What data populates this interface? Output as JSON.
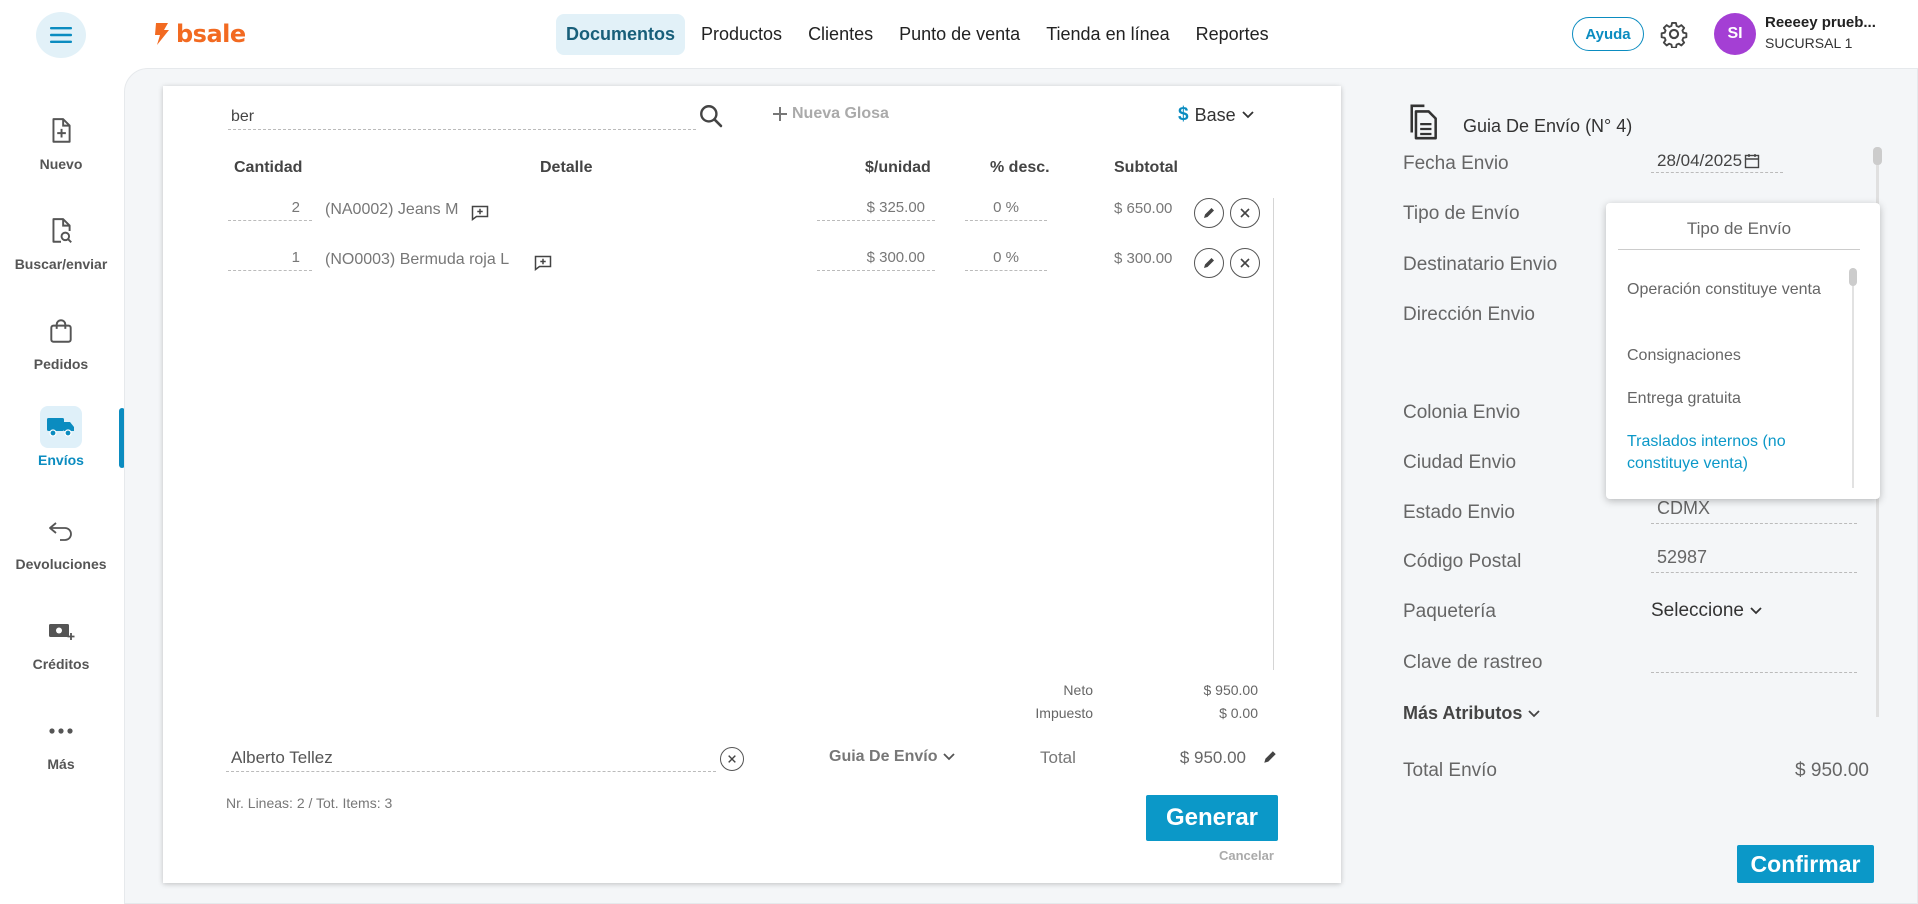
{
  "topbar": {
    "logo_text": "bsale",
    "nav": [
      "Documentos",
      "Productos",
      "Clientes",
      "Punto de venta",
      "Tienda en línea",
      "Reportes"
    ],
    "help_label": "Ayuda",
    "avatar_initials": "SI",
    "user_name": "Reeeey prueb...",
    "user_branch": "SUCURSAL 1"
  },
  "sidebar": {
    "items": [
      {
        "label": "Nuevo",
        "icon": "file-plus-icon"
      },
      {
        "label": "Buscar/enviar",
        "icon": "file-search-icon"
      },
      {
        "label": "Pedidos",
        "icon": "shopping-bag-icon"
      },
      {
        "label": "Envíos",
        "icon": "truck-icon"
      },
      {
        "label": "Devoluciones",
        "icon": "return-arrow-icon"
      },
      {
        "label": "Créditos",
        "icon": "money-plus-icon"
      },
      {
        "label": "Más",
        "icon": "more-dots-icon"
      }
    ],
    "active_index": 3
  },
  "document": {
    "search_value": "ber",
    "new_glosa_label": "Nueva Glosa",
    "currency_symbol": "$",
    "currency_label": "Base",
    "columns": {
      "qty": "Cantidad",
      "detail": "Detalle",
      "unit_price": "$/unidad",
      "discount": "% desc.",
      "subtotal": "Subtotal"
    },
    "rows": [
      {
        "qty": "2",
        "detail": "(NA0002) Jeans M",
        "unit_price": "$ 325.00",
        "discount": "0 %",
        "subtotal": "$ 650.00"
      },
      {
        "qty": "1",
        "detail": "(NO0003) Bermuda roja L",
        "unit_price": "$ 300.00",
        "discount": "0 %",
        "subtotal": "$ 300.00"
      }
    ],
    "summary": {
      "neto_label": "Neto",
      "neto_value": "$ 950.00",
      "tax_label": "Impuesto",
      "tax_value": "$ 0.00"
    },
    "client_value": "Alberto Tellez",
    "doc_type": "Guia De Envío",
    "total_label": "Total",
    "total_value": "$ 950.00",
    "lines_info": "Nr. Lineas: 2 / Tot. Items: 3",
    "generate_label": "Generar",
    "cancel_label": "Cancelar"
  },
  "shipping": {
    "title": "Guia De Envío (N° 4)",
    "labels": {
      "fecha": "Fecha Envio",
      "tipo": "Tipo de Envío",
      "destinatario": "Destinatario Envio",
      "direccion": "Dirección Envio",
      "colonia": "Colonia Envio",
      "ciudad": "Ciudad Envio",
      "estado": "Estado Envio",
      "cp": "Código Postal",
      "paqueteria": "Paquetería",
      "clave": "Clave de rastreo"
    },
    "fecha_value": "28/04/2025",
    "estado_value": "CDMX",
    "cp_value": "52987",
    "paqueteria_value": "Seleccione",
    "more_attributes": "Más Atributos",
    "total_label": "Total Envío",
    "total_value": "$ 950.00",
    "confirm_label": "Confirmar"
  },
  "dropdown": {
    "title": "Tipo de Envío",
    "options": [
      "Operación constituye venta",
      "Consignaciones",
      "Entrega gratuita",
      "Traslados internos (no constituye venta)"
    ],
    "selected_index": 3
  },
  "colors": {
    "accent": "#0b98c8",
    "brand": "#f26a21",
    "avatar": "#a43fd4"
  }
}
